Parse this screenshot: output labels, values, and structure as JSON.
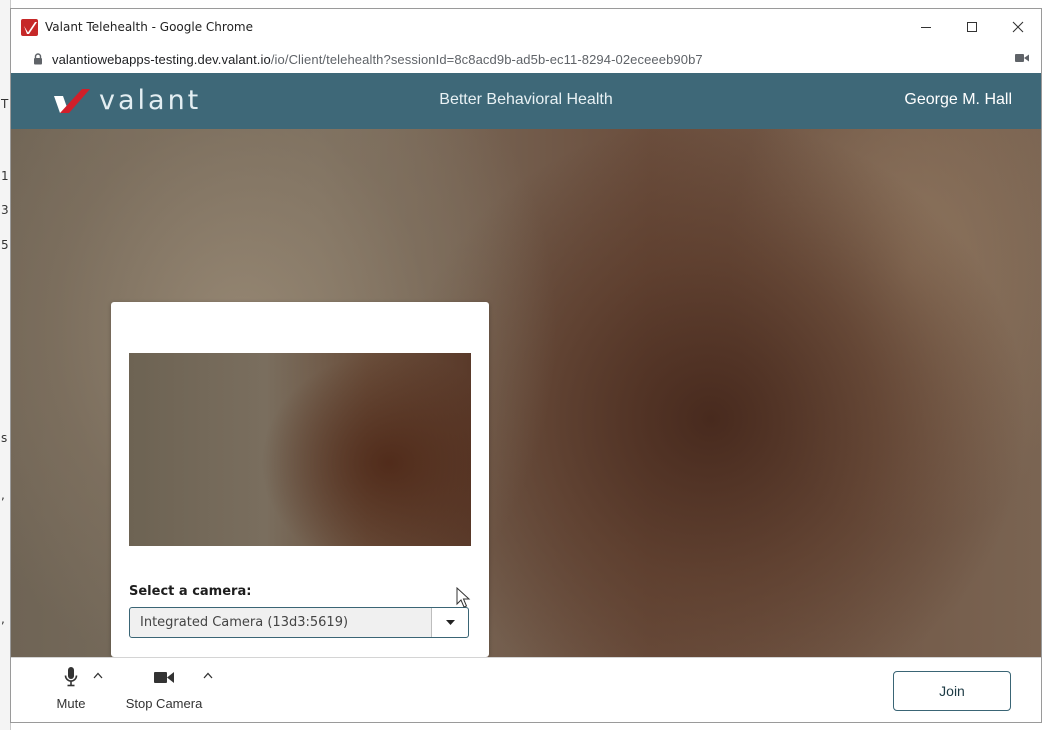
{
  "browser": {
    "window_title": "Valant Telehealth - Google Chrome",
    "url_host": "valantiowebapps-testing.dev.valant.io",
    "url_path": "/io/Client/telehealth?sessionId=8c8acd9b-ad5b-ec11-8294-02eceeeb90b7",
    "controls": {
      "minimize": "–",
      "maximize": "☐",
      "close": "✕"
    }
  },
  "header": {
    "logo_text": "valant",
    "practice_name": "Better Behavioral Health",
    "user_name": "George M. Hall"
  },
  "camera_modal": {
    "select_label": "Select a camera:",
    "selected_camera": "Integrated Camera (13d3:5619)"
  },
  "toolbar": {
    "mute_label": "Mute",
    "stop_camera_label": "Stop Camera",
    "join_label": "Join"
  },
  "background_chars": [
    "T",
    "1",
    "3",
    "5",
    "s",
    ",",
    ","
  ],
  "colors": {
    "header_bg": "#3e6878",
    "brand_red": "#c62828",
    "accent_border": "#3a6575"
  }
}
